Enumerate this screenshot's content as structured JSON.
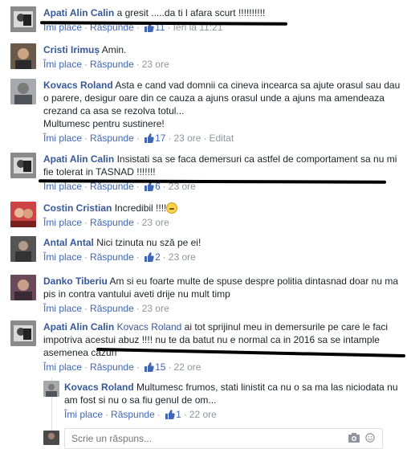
{
  "actions": {
    "like": "Îmi place",
    "reply": "Răspunde"
  },
  "colors": {
    "link": "#365899",
    "action": "#4267b2",
    "meta": "#90949c",
    "ink": "#000000"
  },
  "comments": [
    {
      "author": "Apati Alin Calin",
      "text": "a gresit .....da ti l afara scurt !!!!!!!!!!",
      "likes": "11",
      "time": "Ieri la 11:21",
      "edited": ""
    },
    {
      "author": "Cristi Irimuș",
      "text": "Amin.",
      "likes": "",
      "time": "23 ore",
      "edited": ""
    },
    {
      "author": "Kovacs Roland",
      "text": "Asta e cand vad domnii ca cineva incearca sa ajute orasul sau dau o parere, desigur oare din ce cauza a ajuns orasul unde a ajuns ma amendeaza crezand ca asa se rezolva totul...",
      "text2": "Multumesc pentru sustinere!",
      "likes": "17",
      "time": "23 ore",
      "edited": "Editat"
    },
    {
      "author": "Apati Alin Calin",
      "text": "Insistati sa se faca demersuri ca astfel de comportament sa nu mi fie tolerat in TASNAD !!!!!!!",
      "likes": "6",
      "time": "23 ore",
      "edited": ""
    },
    {
      "author": "Costin Cristian",
      "text": "Incredibil !!!!",
      "likes": "",
      "time": "23 ore",
      "edited": ""
    },
    {
      "author": "Antal Antal",
      "text": "Nici tzinuta nu sză pe ei!",
      "likes": "2",
      "time": "23 ore",
      "edited": ""
    },
    {
      "author": "Danko Tiberiu",
      "text": "Am si eu foarte multe de spuse despre politia dintasnad doar nu ma pis in contra vantului aveti drije nu mult timp",
      "likes": "",
      "time": "23 ore",
      "edited": ""
    },
    {
      "author": "Apati Alin Calin",
      "mention": "Kovacs Roland",
      "text": "ai tot sprijinul meu in demersurile pe care le faci impotriva acestui abuz !!!! nu te da batut nu e normal ca in 2016 sa se intample asemenea cazuri",
      "likes": "15",
      "time": "22 ore",
      "edited": ""
    }
  ],
  "reply": {
    "author": "Kovacs Roland",
    "text": "Multumesc frumos, stati linistit ca nu o sa ma las niciodata nu am fost si nu o sa fiu genul de om...",
    "likes": "1",
    "time": "22 ore"
  },
  "reply_box": {
    "placeholder": "Scrie un răspuns..."
  }
}
